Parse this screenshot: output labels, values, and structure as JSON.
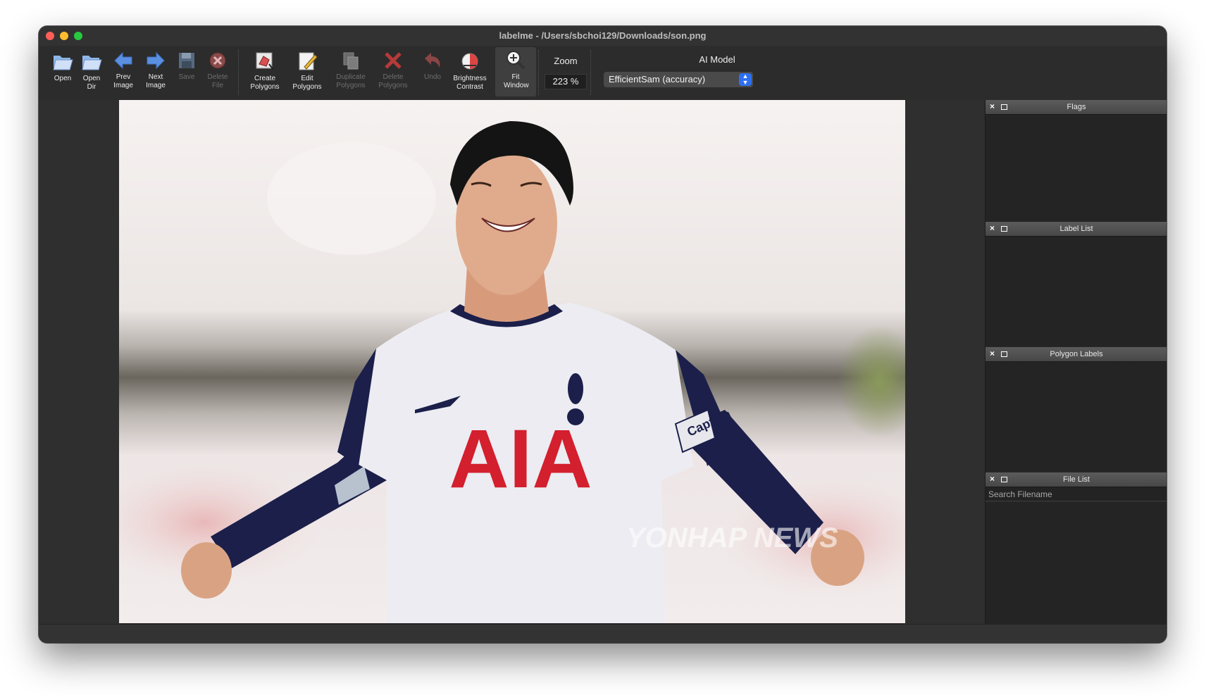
{
  "window": {
    "title": "labelme - /Users/sbchoi129/Downloads/son.png"
  },
  "toolbar": {
    "open": "Open",
    "open_dir": "Open Dir",
    "prev_image": "Prev Image",
    "next_image": "Next Image",
    "save": "Save",
    "delete_file": "Delete File",
    "create_polygons": "Create Polygons",
    "edit_polygons": "Edit Polygons",
    "duplicate_polygons": "Duplicate Polygons",
    "delete_polygons": "Delete Polygons",
    "undo": "Undo",
    "brightness_contrast": "Brightness Contrast",
    "fit_window": "Fit Window",
    "zoom_label": "Zoom",
    "zoom_value": "223 %",
    "ai_model_label": "AI Model",
    "ai_model_value": "EfficientSam (accuracy)"
  },
  "canvas": {
    "jersey_text": "AIA",
    "armband_text": "Captain",
    "watermark": "YONHAP NEWS"
  },
  "docks": {
    "flags": "Flags",
    "label_list": "Label List",
    "polygon_labels": "Polygon Labels",
    "file_list": "File List",
    "search_placeholder": "Search Filename"
  },
  "colors": {
    "window_bg": "#2f2f2f",
    "accent_blue": "#2e6ff2",
    "jersey_red": "#d31f2e",
    "navy": "#1b1f4a"
  }
}
